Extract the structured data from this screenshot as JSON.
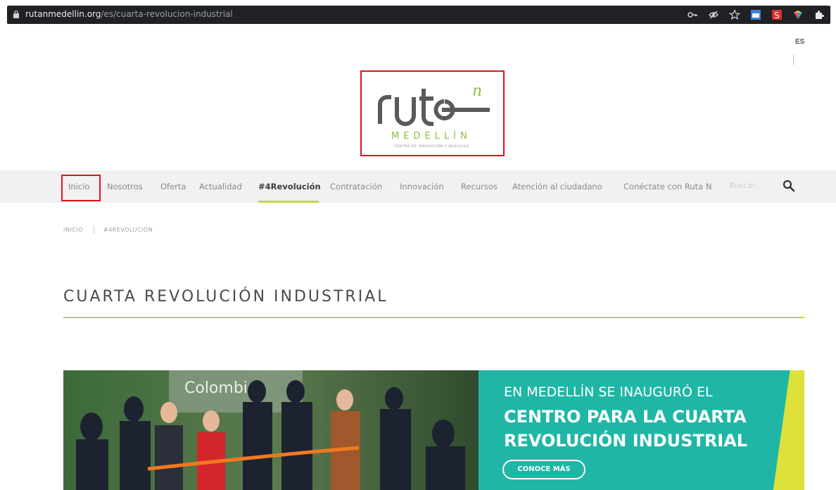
{
  "browser": {
    "url_domain": "rutanmedellin.org",
    "url_path": "/es/cuarta-revolucion-industrial",
    "toolbar_icons": [
      "key-icon",
      "eye-off-icon",
      "star-icon",
      "extension-blue-icon",
      "extension-red-s-icon",
      "extension-color-icon",
      "puzzle-icon"
    ]
  },
  "language": {
    "current": "ES"
  },
  "logo": {
    "word": "ruta",
    "superscript": "n",
    "city": "MEDELLÍN",
    "tagline": "CENTRO DE INNOVACIÓN Y NEGOCIOS",
    "colors": {
      "word": "#5a5a5a",
      "accent": "#8bbf3f"
    }
  },
  "nav": {
    "items": [
      {
        "label": "Inicio"
      },
      {
        "label": "Nosotros"
      },
      {
        "label": "Oferta"
      },
      {
        "label": "Actualidad"
      },
      {
        "label": "#4Revolución"
      },
      {
        "label": "Contratación"
      },
      {
        "label": "Innovación"
      },
      {
        "label": "Recursos"
      },
      {
        "label": "Atención al ciudadano"
      },
      {
        "label": "Conéctate con Ruta N"
      }
    ],
    "active_index": 4,
    "search_placeholder": "Buscar..."
  },
  "breadcrumb": {
    "items": [
      "INICIO",
      "#4REVOLUCIÓN"
    ]
  },
  "page": {
    "title": "CUARTA REVOLUCIÓN INDUSTRIAL"
  },
  "banner": {
    "photo_sign": "Colombia",
    "line1": "EN MEDELLÍN SE INAUGURÓ EL",
    "line2": "CENTRO PARA LA CUARTA",
    "line3": "REVOLUCIÓN INDUSTRIAL",
    "cta": "CONOCE MÁS",
    "colors": {
      "teal": "#1fb6a6",
      "yellow": "#dde13a"
    }
  },
  "colors": {
    "accent_green": "#c5d63e",
    "highlight_red": "#e0141e"
  }
}
